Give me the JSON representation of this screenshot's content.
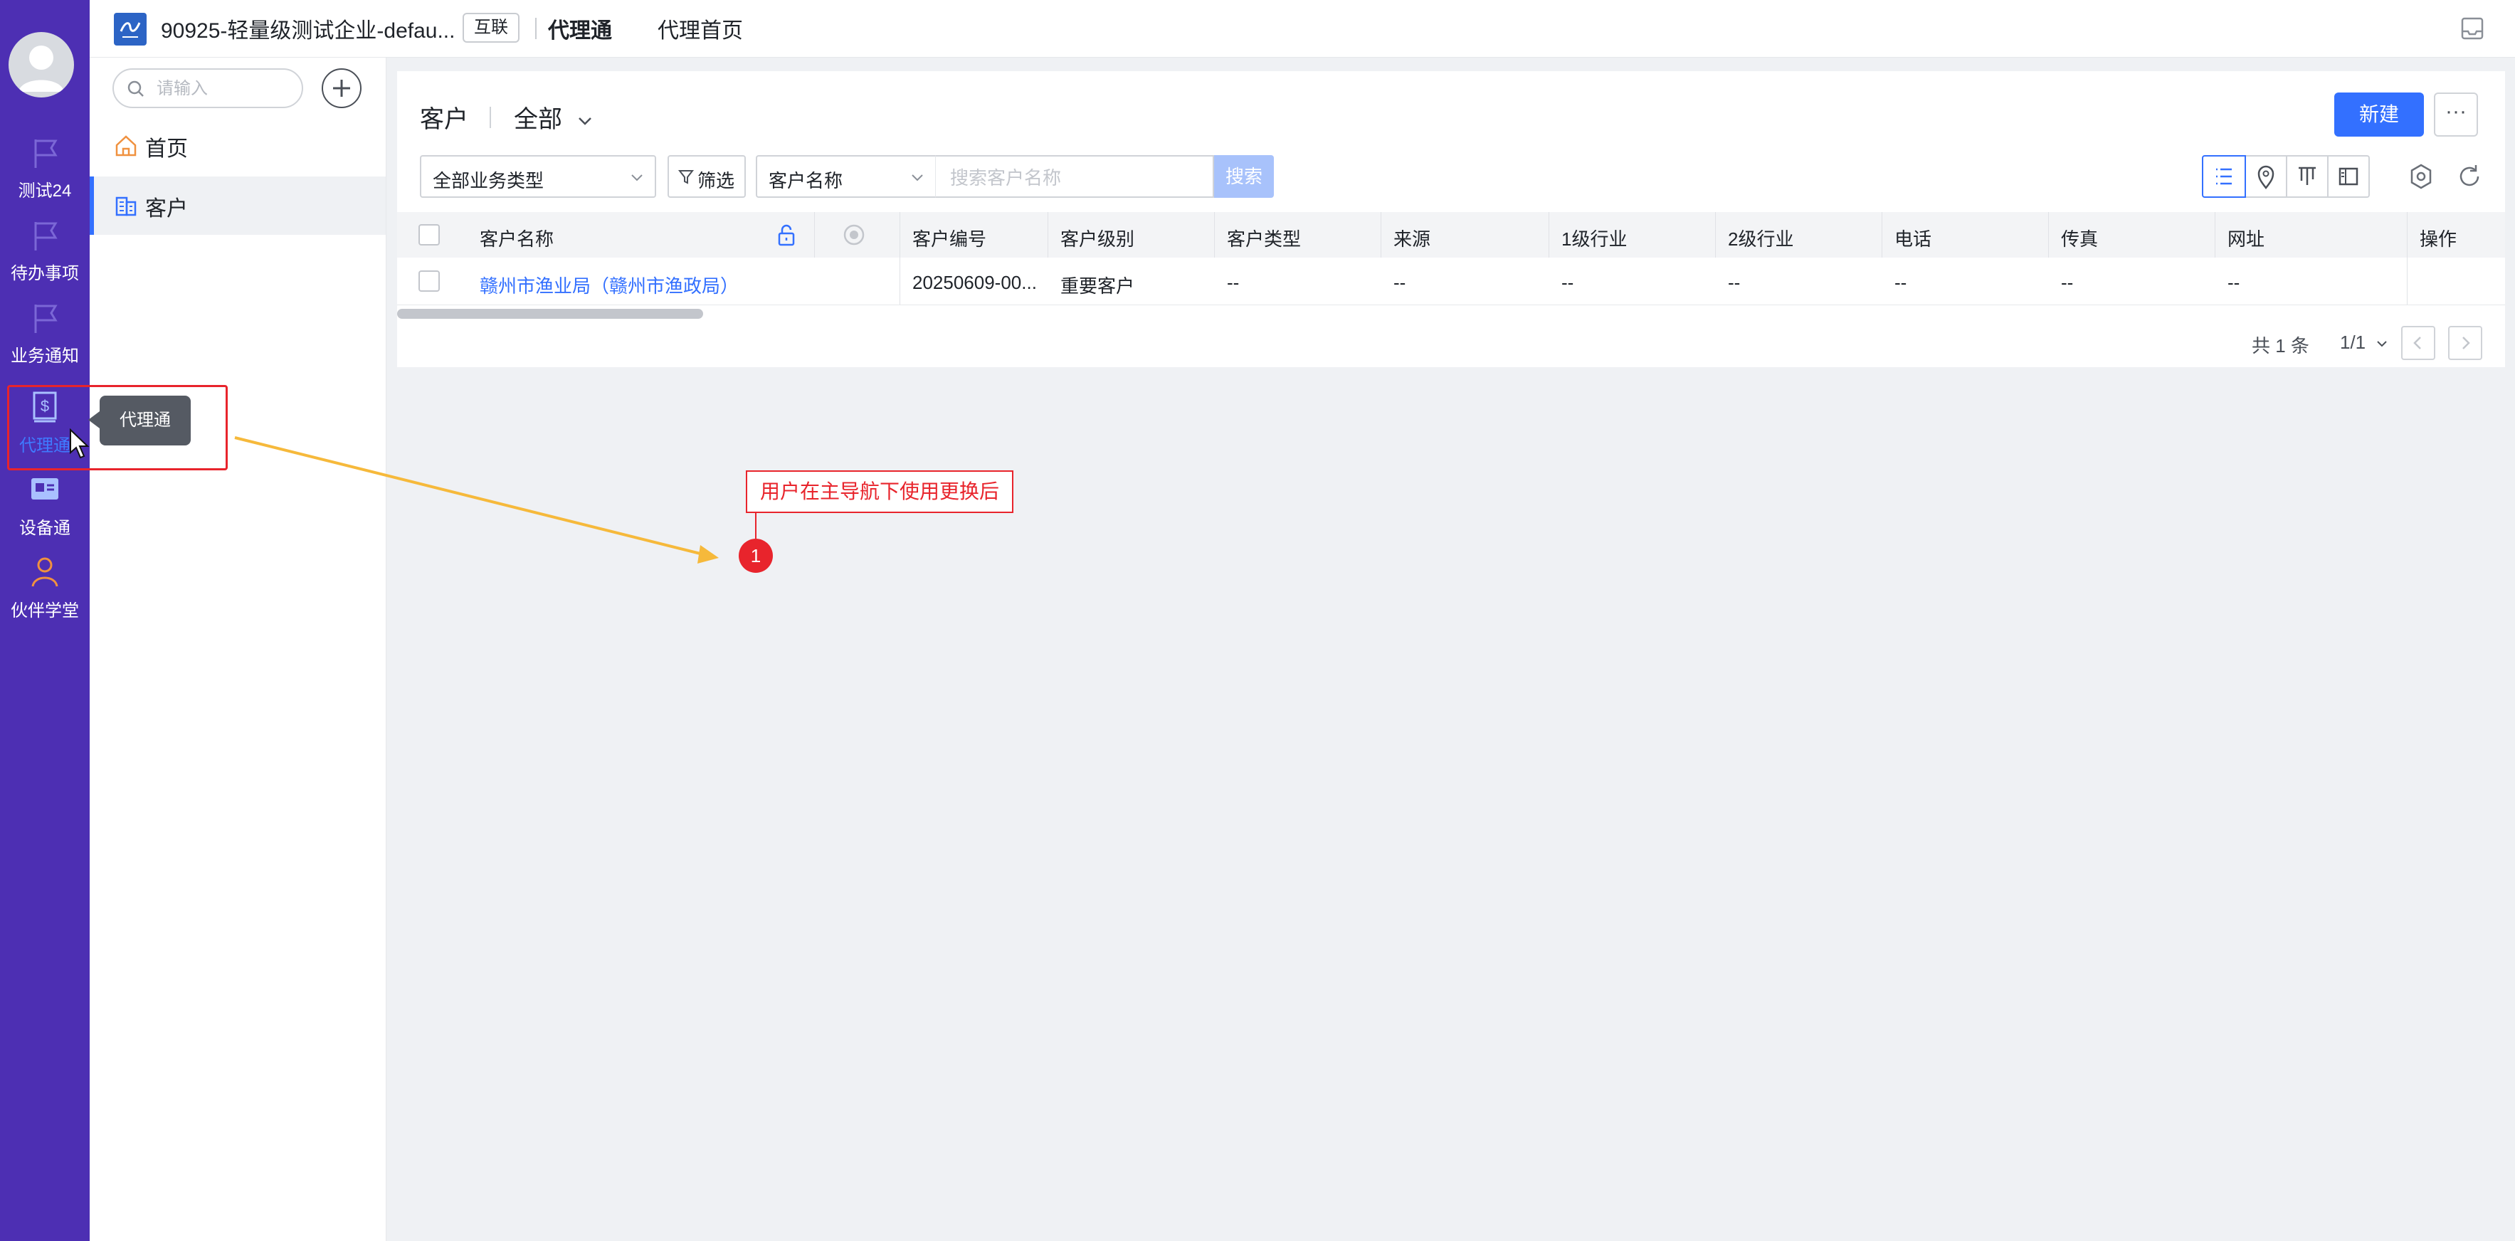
{
  "rail": {
    "items": [
      {
        "label": "测试24",
        "icon": "flag-icon"
      },
      {
        "label": "待办事项",
        "icon": "flag-icon"
      },
      {
        "label": "业务通知",
        "icon": "flag-icon"
      },
      {
        "label": "代理通",
        "icon": "dollar-doc-icon",
        "active": true
      },
      {
        "label": "设备通",
        "icon": "id-card-icon"
      },
      {
        "label": "伙伴学堂",
        "icon": "person-icon"
      }
    ]
  },
  "topbar": {
    "app_title": "90925-轻量级测试企业-defau...",
    "badge": "互联",
    "module": "代理通",
    "home_link": "代理首页"
  },
  "sidebar": {
    "search_placeholder": "请输入",
    "items": [
      {
        "label": "首页",
        "icon": "home-icon"
      },
      {
        "label": "客户",
        "icon": "building-icon",
        "selected": true
      }
    ]
  },
  "main": {
    "title": "客户",
    "view_filter": "全部",
    "new_button": "新建",
    "more_button": "···",
    "biz_type_select": "全部业务类型",
    "filter_button": "筛选",
    "field_select": "客户名称",
    "search_placeholder": "搜索客户名称",
    "search_button": "搜索"
  },
  "table": {
    "columns": [
      "客户名称",
      "客户编号",
      "客户级别",
      "客户类型",
      "来源",
      "1级行业",
      "2级行业",
      "电话",
      "传真",
      "网址",
      "操作"
    ],
    "rows": [
      [
        "赣州市渔业局（赣州市渔政局）",
        "20250609-00...",
        "重要客户",
        "--",
        "--",
        "--",
        "--",
        "--",
        "--",
        "--",
        ""
      ]
    ]
  },
  "pager": {
    "total": "共 1 条",
    "page": "1/1"
  },
  "annotations": {
    "tooltip": "代理通",
    "note": "用户在主导航下使用更换后",
    "step": "1"
  },
  "colors": {
    "rail": "#4d2fb3",
    "accent": "#3370ff",
    "annotation_red": "#e8242c",
    "arrow_orange": "#f6b93b"
  }
}
